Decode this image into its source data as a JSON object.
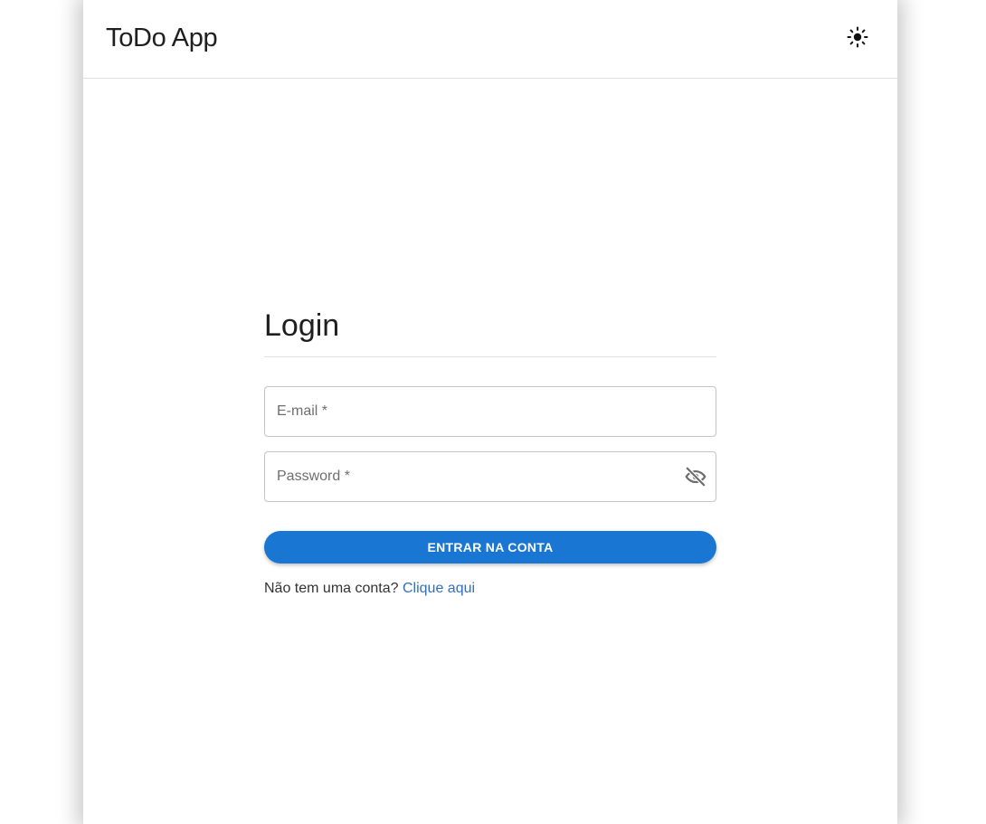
{
  "header": {
    "app_title": "ToDo App",
    "theme_icon": "sun-icon"
  },
  "login": {
    "title": "Login",
    "email_placeholder": "E-mail *",
    "email_value": "",
    "password_placeholder": "Password *",
    "password_value": "",
    "password_visibility_icon": "eye-off-icon",
    "submit_label": "ENTRAR NA CONTA",
    "signup_prompt": "Não tem uma conta?",
    "signup_link": "Clique aqui"
  },
  "colors": {
    "primary": "#1976d2",
    "link": "#2f6fbf"
  }
}
